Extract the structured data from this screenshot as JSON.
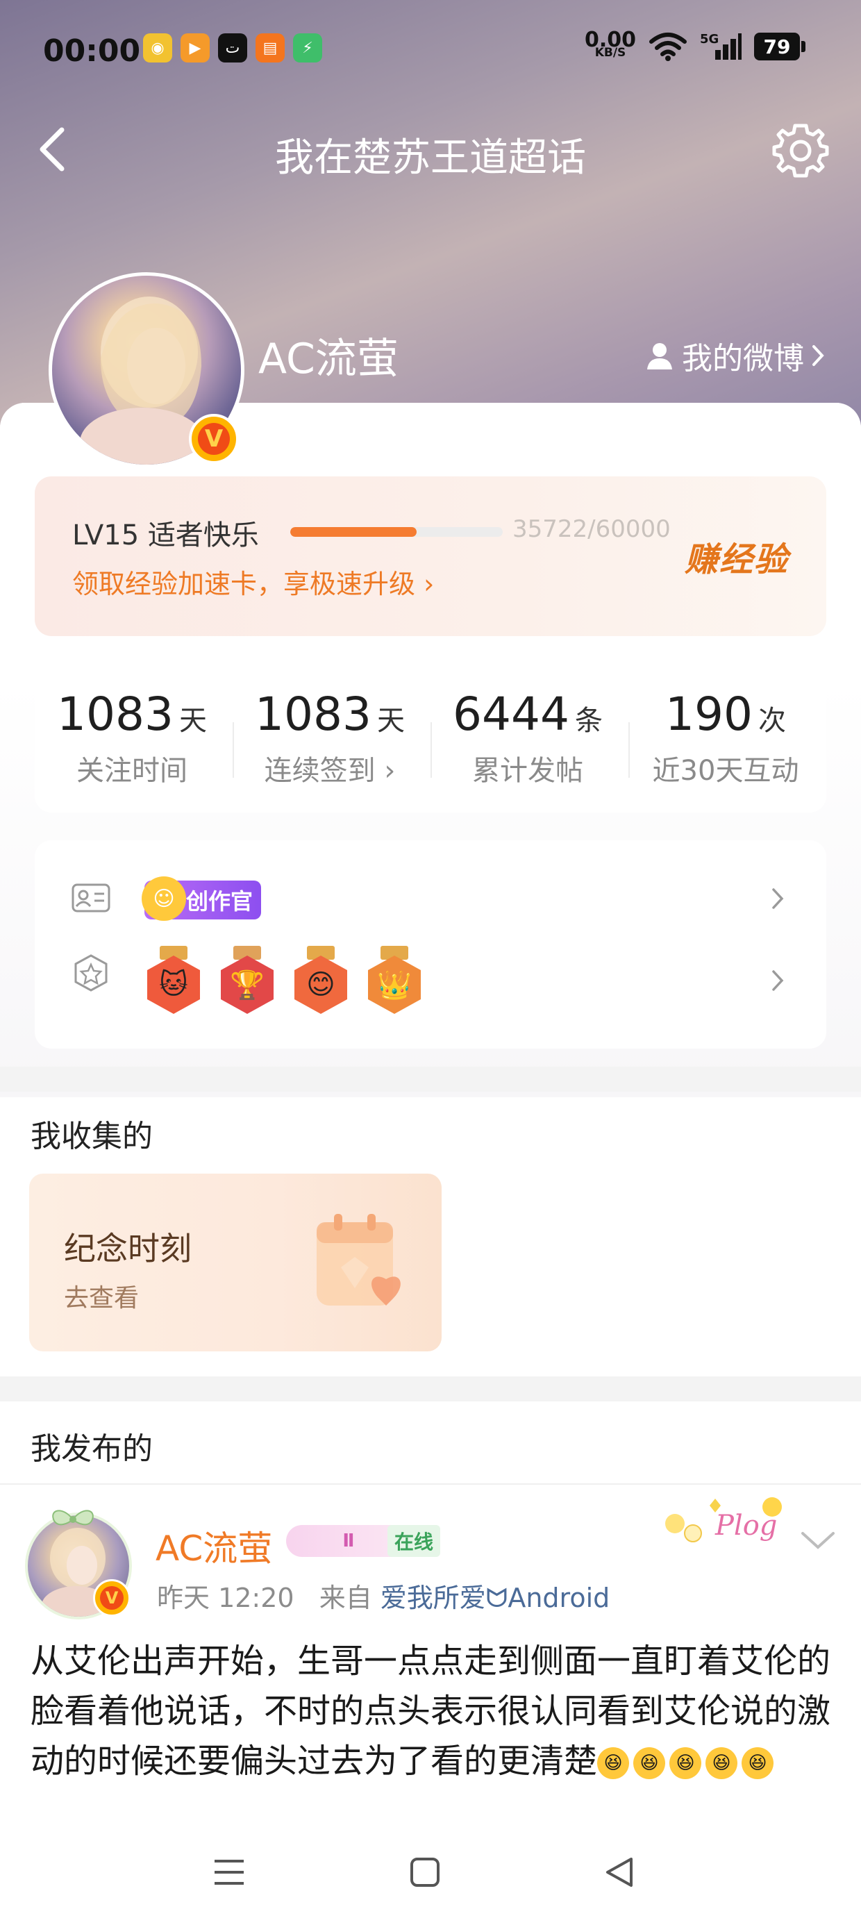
{
  "status_bar": {
    "time": "00:00",
    "net_speed_value": "0.00",
    "net_speed_unit": "KB/S",
    "signal": "5G",
    "battery": "79"
  },
  "nav": {
    "title": "我在楚苏王道超话"
  },
  "profile": {
    "username": "AC流萤",
    "my_weibo_label": "我的微博",
    "verified_badge": "V"
  },
  "level": {
    "title": "LV15 适者快乐",
    "exp_text": "35722/60000",
    "progress_fraction": 0.5954,
    "speedup_link": "领取经验加速卡，享极速升级",
    "earn_exp_label": "赚经验"
  },
  "stats": [
    {
      "value": "1083",
      "unit": "天",
      "label": "关注时间"
    },
    {
      "value": "1083",
      "unit": "天",
      "label": "连续签到"
    },
    {
      "value": "6444",
      "unit": "条",
      "label": "累计发帖"
    },
    {
      "value": "190",
      "unit": "次",
      "label": "近30天互动"
    }
  ],
  "badges": {
    "creator_label": "创作官"
  },
  "collected": {
    "section_title": "我收集的",
    "card_title": "纪念时刻",
    "card_sub": "去查看"
  },
  "published": {
    "section_title": "我发布的"
  },
  "post": {
    "author": "AC流萤",
    "level_pill": "Ⅱ",
    "online_tag": "在线",
    "time": "昨天 12:20",
    "from_label": "来自",
    "source": "爱我所爱ᗢAndroid",
    "plog_label": "Plog",
    "body": "从艾伦出声开始，生哥一点点走到侧面一直盯着艾伦的脸看着他说话，不时的点头表示很认同看到艾伦说的激动的时候还要偏头过去为了看的更清楚"
  },
  "colors": {
    "accent_orange": "#f57c31",
    "creator_purple": "#9b5cf2",
    "online_green": "#3aa35a",
    "source_blue": "#4b6b98"
  }
}
